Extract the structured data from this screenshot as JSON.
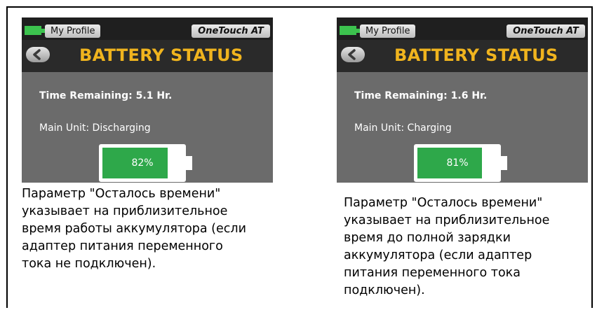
{
  "panels": [
    {
      "profile_label": "My Profile",
      "brand_label": "OneTouch AT",
      "title": "BATTERY STATUS",
      "time_remaining": "Time Remaining: 5.1 Hr.",
      "main_unit_status": "Main Unit: Discharging",
      "battery_percent_text": "82%",
      "battery_level": 0.82,
      "caption": "Параметр \"Осталось времени\" указывает на приблизительное время работы аккумулятора (если адаптер питания переменного тока не подключен)."
    },
    {
      "profile_label": "My Profile",
      "brand_label": "OneTouch AT",
      "title": "BATTERY STATUS",
      "time_remaining": "Time Remaining: 1.6 Hr.",
      "main_unit_status": "Main Unit: Charging",
      "battery_percent_text": "81%",
      "battery_level": 0.81,
      "caption": "Параметр \"Осталось времени\" указывает на приблизительное время до полной зарядки аккумулятора (если адаптер питания переменного тока подключен)."
    }
  ],
  "colors": {
    "title": "#f0b41e",
    "battery_fill": "#2ea84a",
    "status_icon": "#3cc24e",
    "screen_bg": "#6b6b6b"
  },
  "icons": [
    "battery-icon",
    "back-arrow-icon"
  ]
}
